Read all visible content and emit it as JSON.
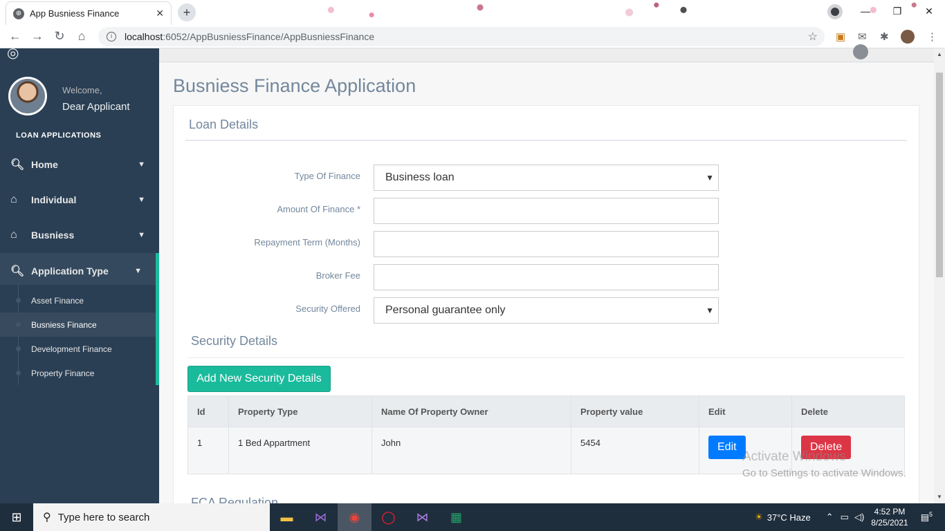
{
  "browser": {
    "tab_title": "App Busniess Finance",
    "url_host": "localhost",
    "url_path": ":6052/AppBusniessFinance/AppBusniessFinance"
  },
  "sidebar": {
    "welcome": "Welcome,",
    "username": "Dear Applicant",
    "section_title": "LOAN APPLICATIONS",
    "items": [
      {
        "label": "Home",
        "icon": "search-icon"
      },
      {
        "label": "Individual",
        "icon": "home-icon"
      },
      {
        "label": "Busniess",
        "icon": "home-icon"
      },
      {
        "label": "Application Type",
        "icon": "search-icon"
      }
    ],
    "subitems": [
      {
        "label": "Asset Finance"
      },
      {
        "label": "Busniess Finance"
      },
      {
        "label": "Development Finance"
      },
      {
        "label": "Property Finance"
      }
    ],
    "accent_color": "#1abb9c"
  },
  "page": {
    "title": "Busniess Finance Application",
    "loan_details_title": "Loan Details",
    "security_details_title": "Security Details",
    "fca_title": "FCA Regulation"
  },
  "form": {
    "type_of_finance_label": "Type Of Finance",
    "type_of_finance_value": "Business loan",
    "amount_label": "Amount Of Finance *",
    "amount_value": "",
    "repayment_label": "Repayment Term (Months)",
    "repayment_value": "",
    "broker_fee_label": "Broker Fee",
    "broker_fee_value": "",
    "security_offered_label": "Security Offered",
    "security_offered_value": "Personal guarantee only"
  },
  "security": {
    "add_button": "Add New Security Details",
    "columns": [
      "Id",
      "Property Type",
      "Name Of Property Owner",
      "Property value",
      "Edit",
      "Delete"
    ],
    "rows": [
      {
        "id": "1",
        "property_type": "1 Bed Appartment",
        "owner": "John",
        "value": "5454",
        "edit": "Edit",
        "delete": "Delete"
      }
    ]
  },
  "watermark": {
    "line1": "Activate Windows",
    "line2": "Go to Settings to activate Windows."
  },
  "taskbar": {
    "search_placeholder": "Type here to search",
    "weather": "37°C  Haze",
    "time": "4:52 PM",
    "date": "8/25/2021",
    "notifications": "5"
  }
}
